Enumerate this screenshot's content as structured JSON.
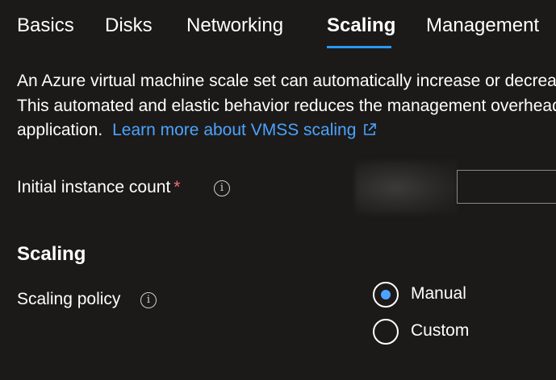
{
  "tabs": [
    {
      "label": "Basics",
      "active": false
    },
    {
      "label": "Disks",
      "active": false
    },
    {
      "label": "Networking",
      "active": false
    },
    {
      "label": "Scaling",
      "active": true
    },
    {
      "label": "Management",
      "active": false
    }
  ],
  "description": {
    "line1": "An Azure virtual machine scale set can automatically increase or decrease",
    "line2": "This automated and elastic behavior reduces the management overhead",
    "line3_text": "application.",
    "link_text": "Learn more about VMSS scaling",
    "link_icon": "external-link-icon"
  },
  "instance_count": {
    "label": "Initial instance count",
    "required_marker": "*",
    "info_icon": "info-icon",
    "value": ""
  },
  "scaling_section": {
    "heading": "Scaling",
    "policy_label": "Scaling policy",
    "info_icon": "info-icon",
    "options": [
      {
        "label": "Manual",
        "selected": true
      },
      {
        "label": "Custom",
        "selected": false
      }
    ]
  },
  "colors": {
    "background": "#1b1a19",
    "accent": "#2899f5",
    "link": "#4ca3ff",
    "required": "#f1707b"
  }
}
